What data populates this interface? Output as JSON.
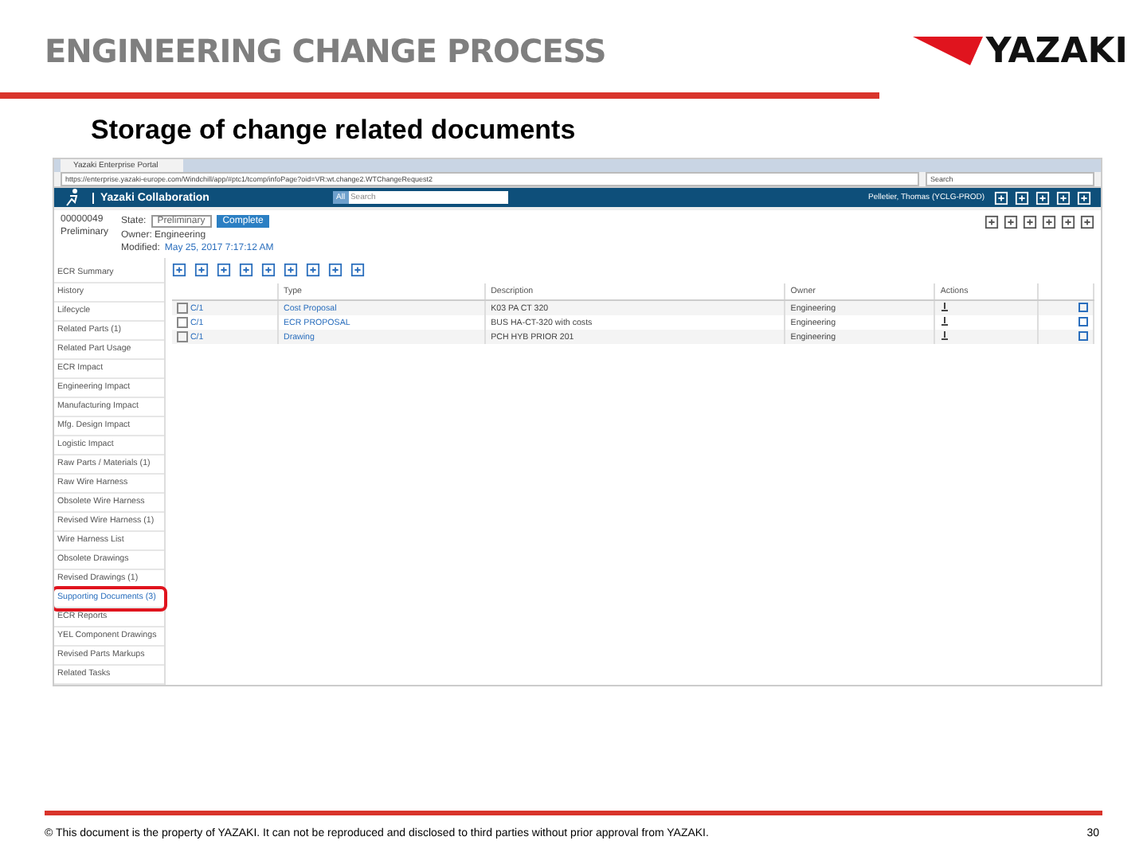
{
  "slide": {
    "title": "ENGINEERING CHANGE PROCESS",
    "logo": "YAZAKI",
    "subtitle": "Storage of change related documents",
    "footer": "© This document is the property of YAZAKI. It can not be reproduced and disclosed to third parties without prior approval from YAZAKI.",
    "page_number": "30"
  },
  "browser": {
    "tab_title": "Yazaki Enterprise Portal",
    "url": "https://enterprise.yazaki-europe.com/Windchill/app/#ptc1/tcomp/infoPage?oid=VR:wt.change2.WTChangeRequest2",
    "search_placeholder": "Search"
  },
  "app_header": {
    "title": "Yazaki Collaboration",
    "search_scope": "All",
    "search_placeholder": "Search",
    "user": "Pelletier, Thomas (YCLG-PROD)"
  },
  "object": {
    "number": "00000049",
    "type": "Preliminary",
    "state_label": "State:",
    "state": "Preliminary",
    "action": "Complete",
    "owner": "Owner: Engineering",
    "modified_label": "Modified:",
    "modified": "May 25, 2017 7:17:12 AM"
  },
  "sidebar": {
    "items": [
      {
        "label": "ECR Summary",
        "selected": false
      },
      {
        "label": "History",
        "selected": false
      },
      {
        "label": "Lifecycle",
        "selected": false
      },
      {
        "label": "Related Parts (1)",
        "selected": false
      },
      {
        "label": "Related Part Usage",
        "selected": false
      },
      {
        "label": "ECR Impact",
        "selected": false
      },
      {
        "label": "Engineering Impact",
        "selected": false
      },
      {
        "label": "Manufacturing Impact",
        "selected": false
      },
      {
        "label": "Mfg. Design Impact",
        "selected": false
      },
      {
        "label": "Logistic Impact",
        "selected": false
      },
      {
        "label": "Raw Parts / Materials (1)",
        "selected": false
      },
      {
        "label": "Raw Wire Harness",
        "selected": false
      },
      {
        "label": "Obsolete Wire Harness",
        "selected": false
      },
      {
        "label": "Revised Wire Harness (1)",
        "selected": false
      },
      {
        "label": "Wire Harness List",
        "selected": false
      },
      {
        "label": "Obsolete Drawings",
        "selected": false
      },
      {
        "label": "Revised Drawings (1)",
        "selected": false
      },
      {
        "label": "Supporting Documents (3)",
        "selected": true
      },
      {
        "label": "ECR Reports",
        "selected": false
      },
      {
        "label": "YEL Component Drawings",
        "selected": false
      },
      {
        "label": "Revised Parts Markups",
        "selected": false
      },
      {
        "label": "Related Tasks",
        "selected": false
      }
    ]
  },
  "table": {
    "columns": [
      "Type",
      "Description",
      "Owner",
      "Actions"
    ],
    "rows": [
      {
        "version": "C/1",
        "type": "Cost Proposal",
        "description": "K03 PA CT 320",
        "owner": "Engineering",
        "checked": false
      },
      {
        "version": "C/1",
        "type": "ECR PROPOSAL",
        "description": "BUS HA-CT-320 with costs",
        "owner": "Engineering",
        "checked": false
      },
      {
        "version": "C/1",
        "type": "Drawing",
        "description": "PCH HYB PRIOR 201",
        "owner": "Engineering",
        "checked": false
      }
    ]
  }
}
